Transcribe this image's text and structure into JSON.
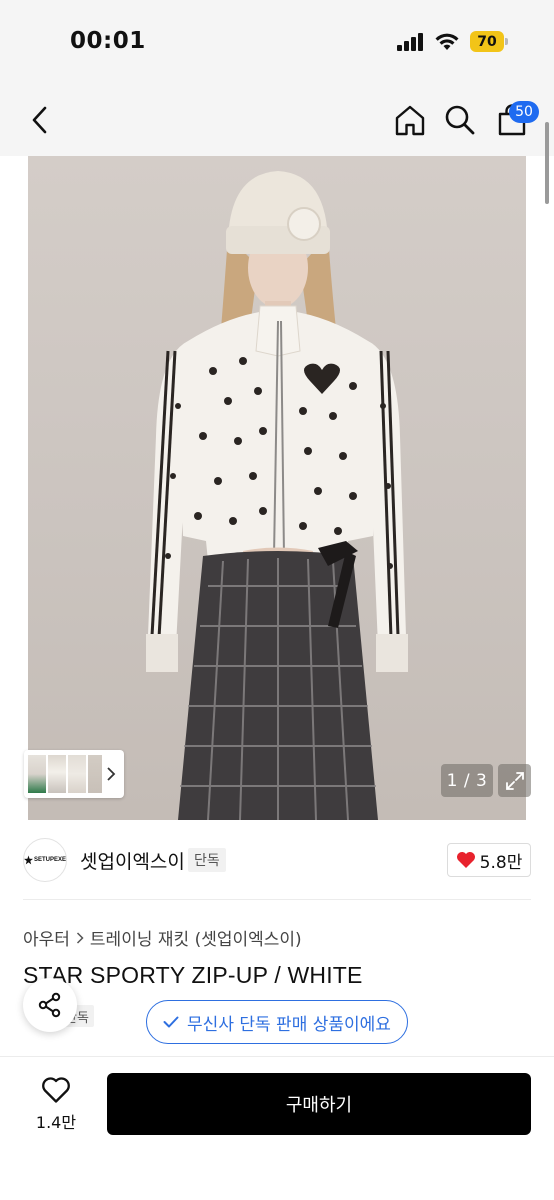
{
  "status_bar": {
    "time": "00:01",
    "battery": "70"
  },
  "nav": {
    "cart_count": "50"
  },
  "gallery": {
    "counter": "1 / 3"
  },
  "brand": {
    "name": "셋업이엑스이",
    "logo_text": "SETUPEXE",
    "exclusive_tag": "단독"
  },
  "likes": {
    "count": "5.8만"
  },
  "breadcrumb": {
    "category": "아우터",
    "subcategory": "트레이닝 재킷 (셋업이엑스이)"
  },
  "product": {
    "title": "STAR SPORTY ZIP-UP / WHITE",
    "tag": "단독"
  },
  "exclusive_notice": "무신사 단독 판매 상품이에요",
  "bottom_bar": {
    "wish_count": "1.4만",
    "buy_label": "구매하기"
  },
  "colors": {
    "accent_blue": "#1f6bf0",
    "heart_red": "#e8222d",
    "buy_button": "#000000",
    "battery": "#f2c418"
  }
}
